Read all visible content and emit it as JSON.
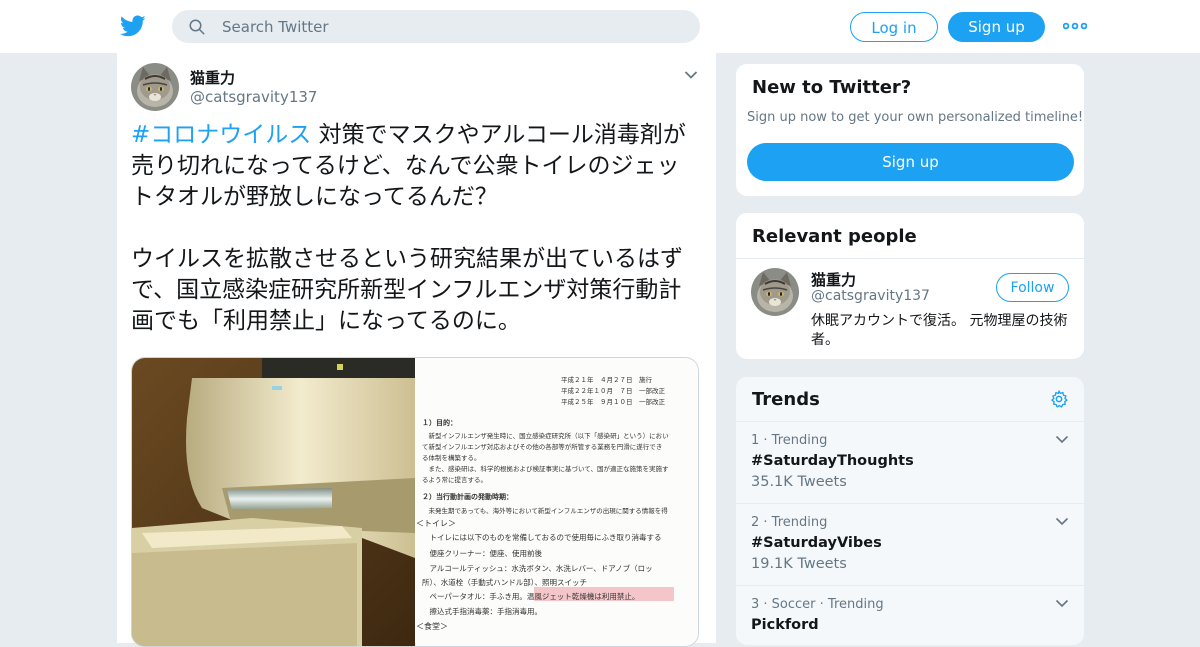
{
  "header": {
    "search_placeholder": "Search Twitter",
    "login_label": "Log in",
    "signup_label": "Sign up"
  },
  "tweet": {
    "display_name": "猫重力",
    "handle": "@catsgravity137",
    "hashtag": "#コロナウイルス",
    "text_line1_rest": " 対策でマスクやアルコール消毒剤が売り切れになってるけど、なんで公衆トイレのジェットタオルが野放しになってるんだ？",
    "text_para2": "ウイルスを拡散させるという研究結果が出ているはずで、国立感染症研究所新型インフルエンザ対策行動計画でも「利用禁止」になってるのに。",
    "media_doc": {
      "dates": [
        "平成２１年　４月２７日　施行",
        "平成２２年１０月　７日　一部改正",
        "平成２５年　９月１０日　一部改正"
      ],
      "lines": [
        "１）目的：",
        "　新型インフルエンザ発生時に、国立感染症研究所（以下「感染研」という）におい",
        "て新型インフルエンザ対応およびその他の各部等が所管する業務を円滑に遂行でき",
        "る体制を構築する。",
        "　また、感染研は、科学的根拠および検証事実に基づいて、国が適正な施策を実施す",
        "るよう常に提言する。",
        "２）当行動計画の発動時期：",
        "　未発生期であっても、海外等において新型インフルエンザの出現に関する情報を得",
        "＜トイレ＞",
        "　トイレには以下のものを常備しておるので使用毎にふき取り消毒する",
        "　便座クリーナー：便座、使用前後",
        "　アルコールティッシュ：水洗ボタン、水洗レバー、ドアノブ（ロッ",
        "所）、水道栓（手動式ハンドル部）、照明スイッチ",
        "　ペーパータオル：手ふき用。温風ジェット乾燥機は利用禁止。",
        "　擦込式手指消毒薬：手指消毒用。",
        "＜食堂＞"
      ]
    }
  },
  "new_to_twitter": {
    "title": "New to Twitter?",
    "subtitle": "Sign up now to get your own personalized timeline!",
    "button": "Sign up"
  },
  "relevant_people": {
    "title": "Relevant people",
    "name": "猫重力",
    "handle": "@catsgravity137",
    "follow": "Follow",
    "bio": "休眠アカウントで復活。 元物理屋の技術者。"
  },
  "trends": {
    "title": "Trends",
    "items": [
      {
        "meta": "1 · Trending",
        "name": "#SaturdayThoughts",
        "count": "35.1K Tweets"
      },
      {
        "meta": "2 · Trending",
        "name": "#SaturdayVibes",
        "count": "19.1K Tweets"
      },
      {
        "meta": "3 · Soccer · Trending",
        "name": "Pickford",
        "count": ""
      }
    ]
  },
  "colors": {
    "accent": "#1da1f2",
    "background": "#e6ecf0",
    "secondary_text": "#657786"
  }
}
